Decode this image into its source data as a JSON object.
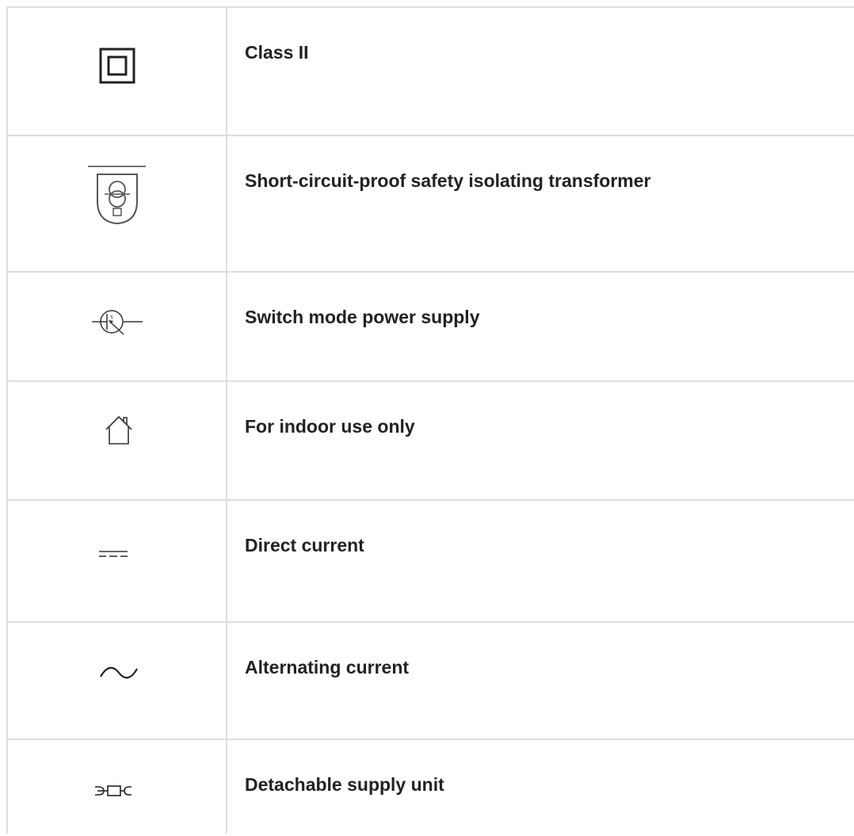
{
  "symbols": [
    {
      "label": "Class II",
      "icon": "class-ii-double-square-icon"
    },
    {
      "label": "Short-circuit-proof safety isolating transformer",
      "icon": "safety-isolating-transformer-icon"
    },
    {
      "label": "Switch mode power supply",
      "icon": "switch-mode-power-supply-icon"
    },
    {
      "label": "For indoor use only",
      "icon": "indoor-house-icon"
    },
    {
      "label": "Direct current",
      "icon": "direct-current-icon"
    },
    {
      "label": "Alternating current",
      "icon": "alternating-current-icon"
    },
    {
      "label": "Detachable supply unit",
      "icon": "detachable-supply-unit-icon"
    }
  ]
}
